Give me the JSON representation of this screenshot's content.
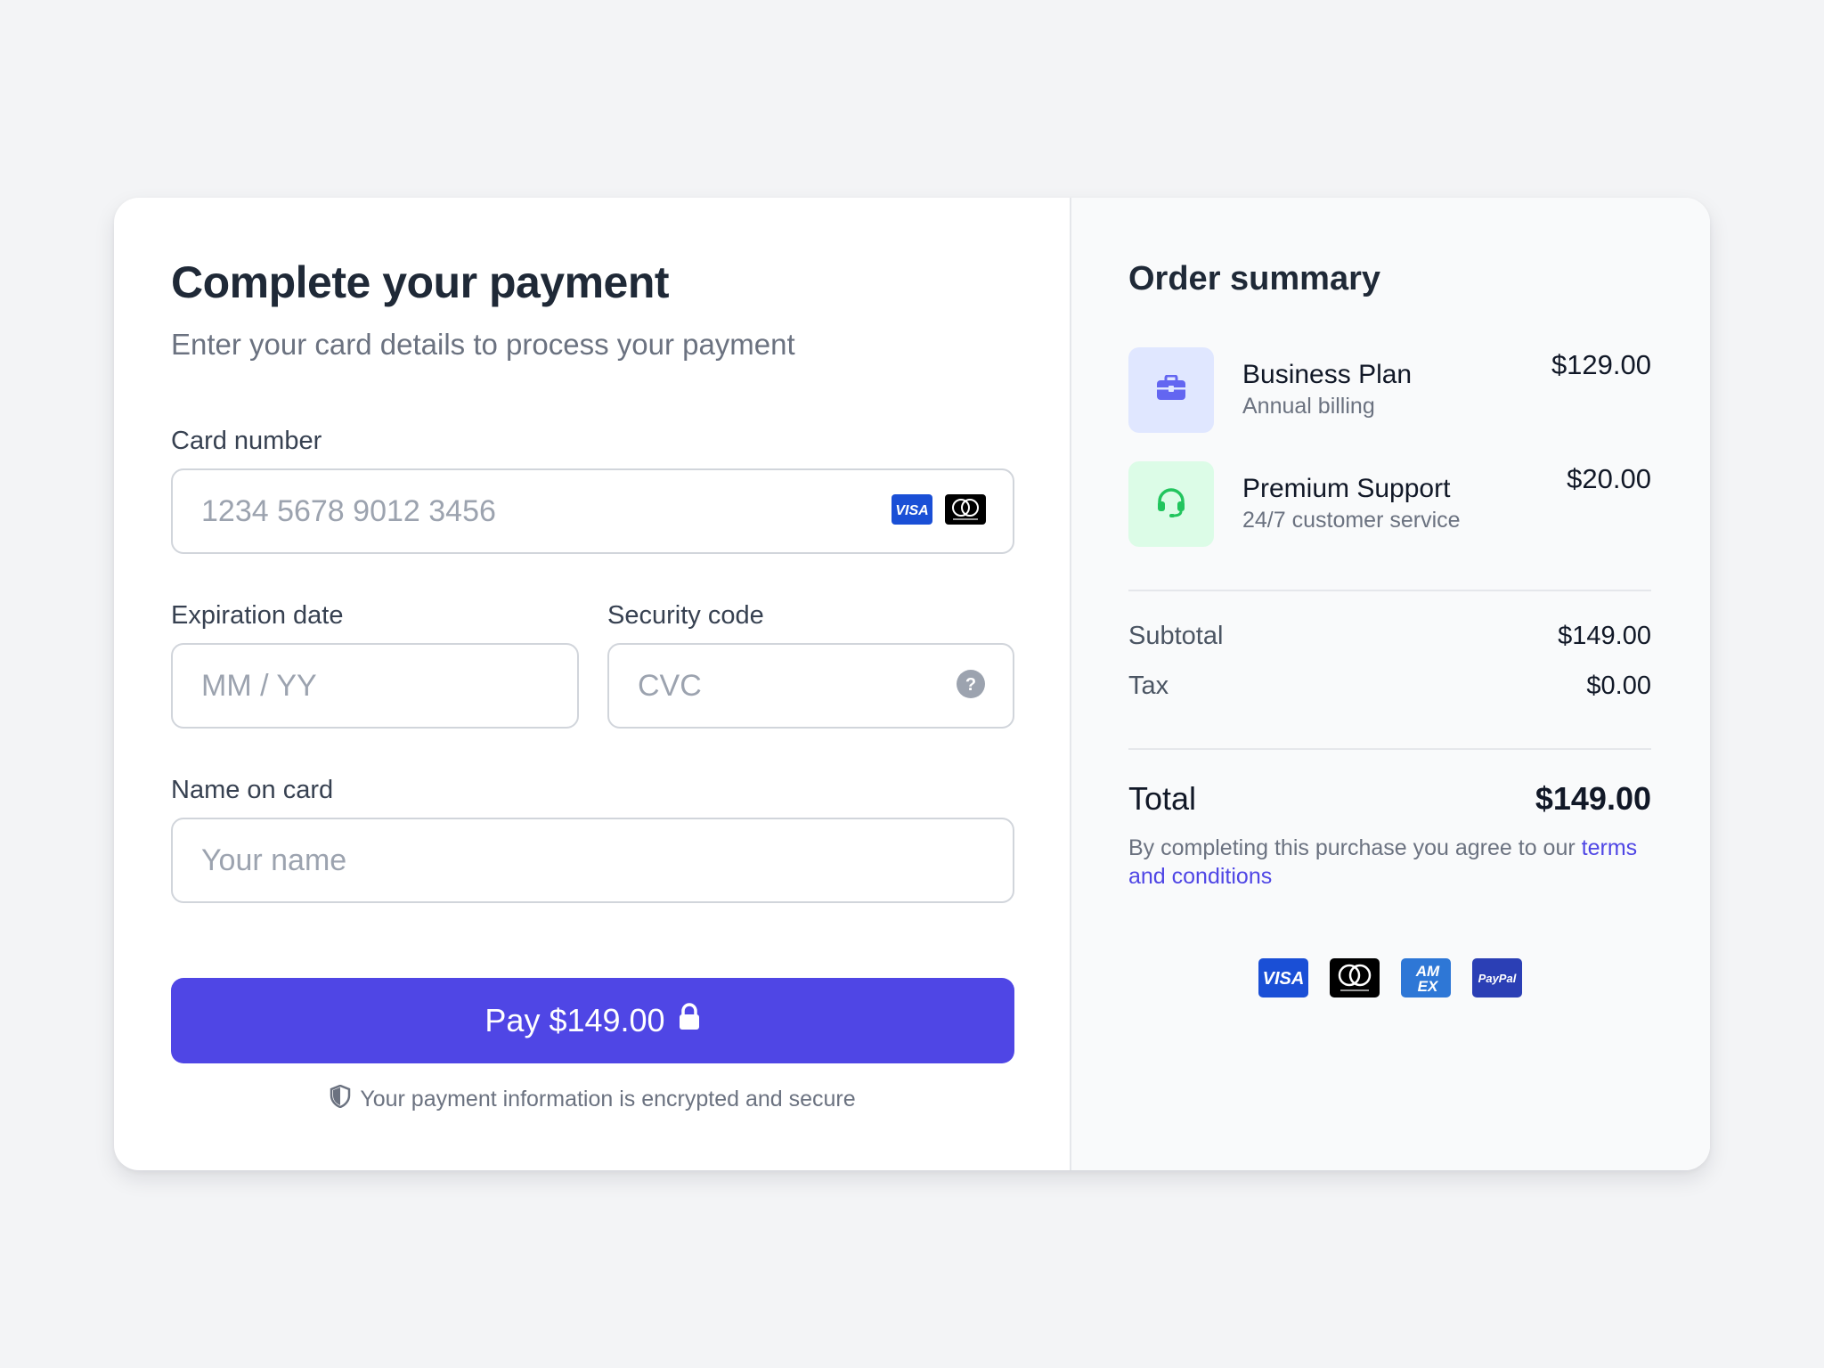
{
  "payment_form": {
    "title": "Complete your payment",
    "subtitle": "Enter your card details to process your payment",
    "card_number": {
      "label": "Card number",
      "placeholder": "1234 5678 9012 3456",
      "value": ""
    },
    "expiration": {
      "label": "Expiration date",
      "placeholder": "MM / YY",
      "value": ""
    },
    "security_code": {
      "label": "Security code",
      "placeholder": "CVC",
      "value": ""
    },
    "name_on_card": {
      "label": "Name on card",
      "placeholder": "Your name",
      "value": ""
    },
    "pay_button_label": "Pay $149.00",
    "secure_note": "Your payment information is encrypted and secure"
  },
  "order_summary": {
    "title": "Order summary",
    "items": [
      {
        "name": "Business Plan",
        "description": "Annual billing",
        "price": "$129.00",
        "icon": "briefcase-icon",
        "icon_bg": "#e0e7ff",
        "icon_color": "#6366f1"
      },
      {
        "name": "Premium Support",
        "description": "24/7 customer service",
        "price": "$20.00",
        "icon": "headset-icon",
        "icon_bg": "#dcfce7",
        "icon_color": "#22c55e"
      }
    ],
    "subtotal_label": "Subtotal",
    "subtotal_value": "$149.00",
    "tax_label": "Tax",
    "tax_value": "$0.00",
    "total_label": "Total",
    "total_value": "$149.00",
    "terms_prefix": "By completing this purchase you agree to our",
    "terms_link": "terms and conditions",
    "accepted_methods": [
      "VISA",
      "mastercard",
      "AM EX",
      "PayPal"
    ]
  },
  "colors": {
    "accent": "#4f46e5",
    "background": "#f3f4f6",
    "visa_blue": "#1a4fd6",
    "amex_blue": "#2e77d6",
    "paypal_blue": "#2b3fb5"
  }
}
